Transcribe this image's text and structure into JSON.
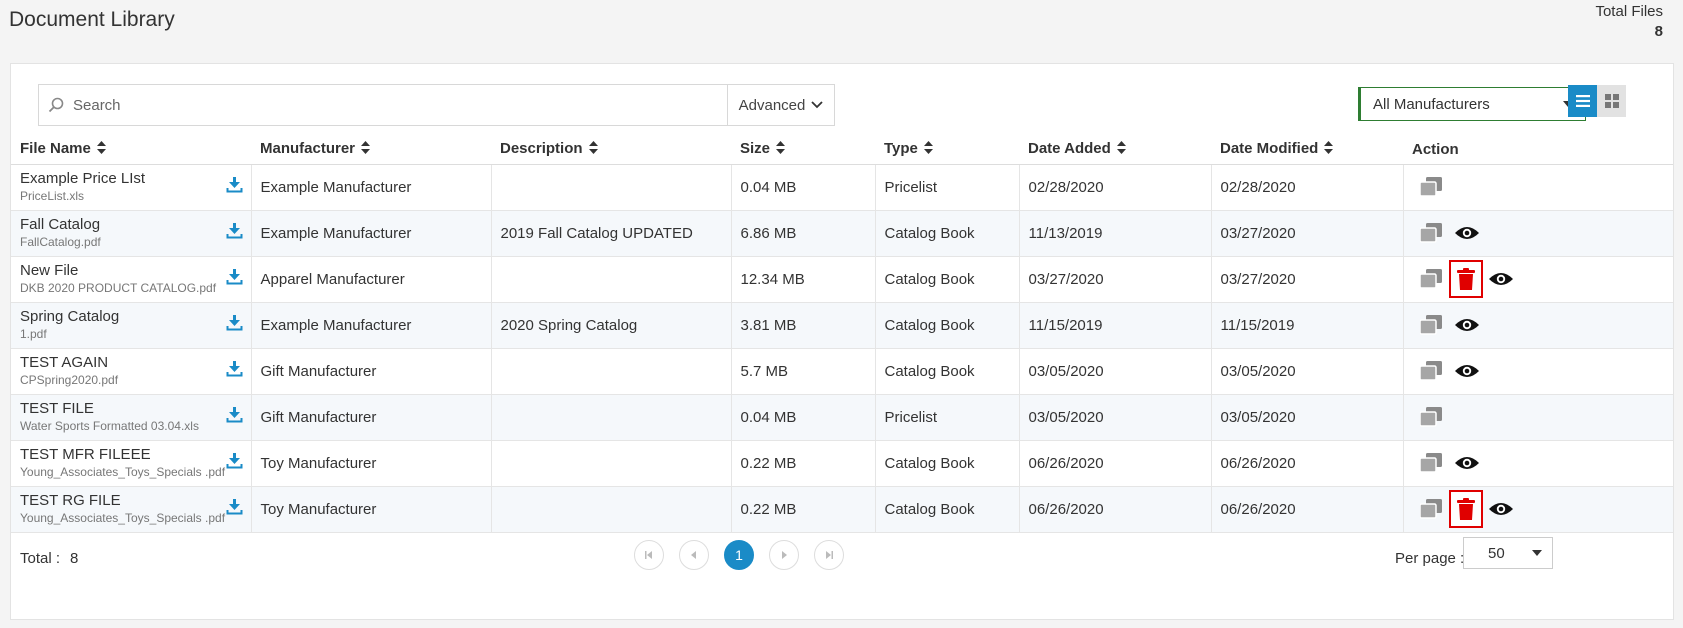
{
  "header": {
    "title": "Document Library",
    "total_label": "Total Files",
    "total_count": "8"
  },
  "toolbar": {
    "search_placeholder": "Search",
    "advanced_label": "Advanced",
    "manufacturer_selected": "All Manufacturers"
  },
  "table": {
    "columns": [
      "File Name",
      "Manufacturer",
      "Description",
      "Size",
      "Type",
      "Date Added",
      "Date Modified",
      "Action"
    ],
    "rows": [
      {
        "title": "Example Price LIst",
        "file": "PriceList.xls",
        "manufacturer": "Example Manufacturer",
        "description": "",
        "size": "0.04 MB",
        "type": "Pricelist",
        "added": "02/28/2020",
        "modified": "02/28/2020",
        "actions": [
          "copy"
        ]
      },
      {
        "title": "Fall Catalog",
        "file": "FallCatalog.pdf",
        "manufacturer": "Example Manufacturer",
        "description": "2019 Fall Catalog UPDATED",
        "size": "6.86 MB",
        "type": "Catalog Book",
        "added": "11/13/2019",
        "modified": "03/27/2020",
        "actions": [
          "copy",
          "view"
        ]
      },
      {
        "title": "New File",
        "file": "DKB 2020 PRODUCT CATALOG.pdf",
        "manufacturer": "Apparel Manufacturer",
        "description": "",
        "size": "12.34 MB",
        "type": "Catalog Book",
        "added": "03/27/2020",
        "modified": "03/27/2020",
        "actions": [
          "copy",
          "delete",
          "view"
        ]
      },
      {
        "title": "Spring Catalog",
        "file": "1.pdf",
        "manufacturer": "Example Manufacturer",
        "description": "2020 Spring Catalog",
        "size": "3.81 MB",
        "type": "Catalog Book",
        "added": "11/15/2019",
        "modified": "11/15/2019",
        "actions": [
          "copy",
          "view"
        ]
      },
      {
        "title": "TEST AGAIN",
        "file": "CPSpring2020.pdf",
        "manufacturer": "Gift Manufacturer",
        "description": "",
        "size": "5.7 MB",
        "type": "Catalog Book",
        "added": "03/05/2020",
        "modified": "03/05/2020",
        "actions": [
          "copy",
          "view"
        ]
      },
      {
        "title": "TEST FILE",
        "file": "Water Sports Formatted 03.04.xls",
        "manufacturer": "Gift Manufacturer",
        "description": "",
        "size": "0.04 MB",
        "type": "Pricelist",
        "added": "03/05/2020",
        "modified": "03/05/2020",
        "actions": [
          "copy"
        ]
      },
      {
        "title": "TEST MFR FILEEE",
        "file": "Young_Associates_Toys_Specials .pdf",
        "manufacturer": "Toy Manufacturer",
        "description": "",
        "size": "0.22 MB",
        "type": "Catalog Book",
        "added": "06/26/2020",
        "modified": "06/26/2020",
        "actions": [
          "copy",
          "view"
        ]
      },
      {
        "title": "TEST RG FILE",
        "file": "Young_Associates_Toys_Specials .pdf",
        "manufacturer": "Toy Manufacturer",
        "description": "",
        "size": "0.22 MB",
        "type": "Catalog Book",
        "added": "06/26/2020",
        "modified": "06/26/2020",
        "actions": [
          "copy",
          "delete",
          "view"
        ]
      }
    ]
  },
  "footer": {
    "total_label": "Total :",
    "total_value": "8",
    "current_page": "1",
    "per_page_label": "Per page :",
    "per_page_value": "50"
  },
  "colors": {
    "accent": "#1a8bc7",
    "download": "#1a8bc7",
    "delete": "#e00000"
  },
  "icons": {
    "download": "download-icon",
    "copy": "copy-icon",
    "view": "eye-icon",
    "delete": "trash-icon"
  }
}
